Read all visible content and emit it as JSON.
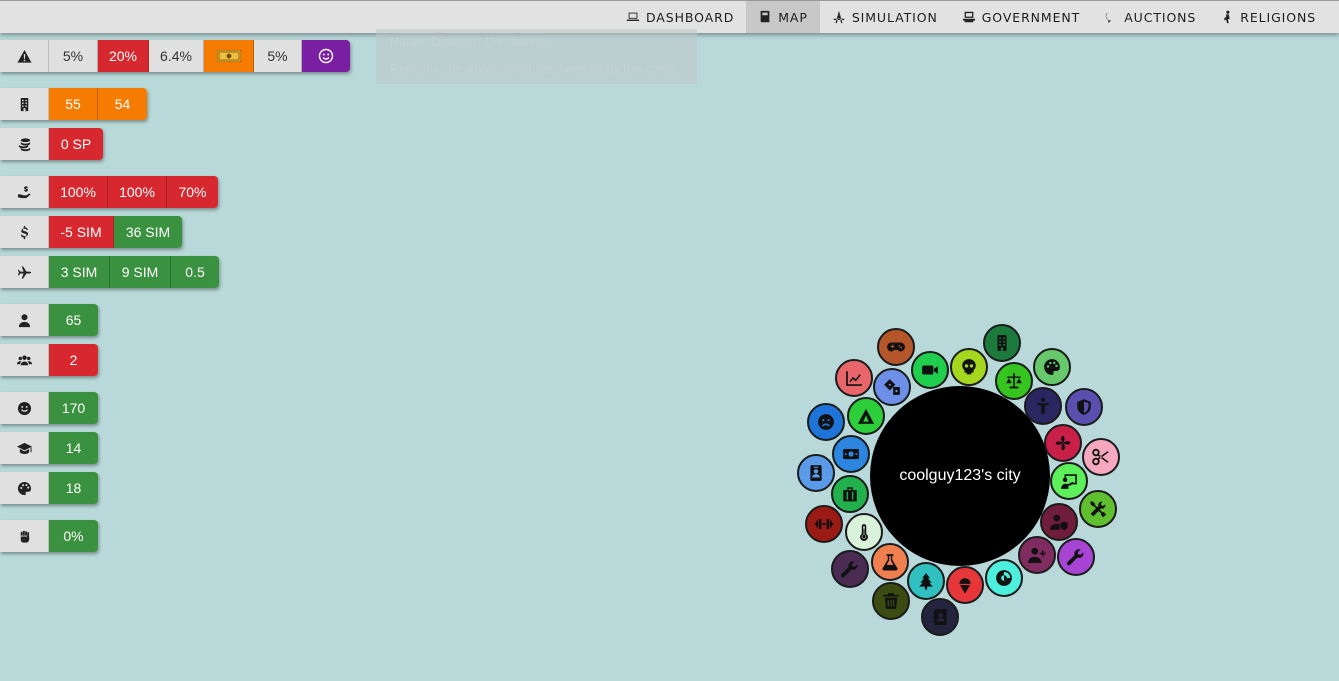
{
  "nav": {
    "items": [
      {
        "label": "DASHBOARD",
        "icon": "laptop-icon"
      },
      {
        "label": "MAP",
        "icon": "book-icon"
      },
      {
        "label": "SIMULATION",
        "icon": "atom-icon"
      },
      {
        "label": "GOVERNMENT",
        "icon": "podium-icon"
      },
      {
        "label": "AUCTIONS",
        "icon": "speech-bubble-icon"
      },
      {
        "label": "RELIGIONS",
        "icon": "praying-icon"
      }
    ],
    "active": "MAP"
  },
  "notice": {
    "line1": "Nature Disaster: 1% chance",
    "line2": "Recently, the whole world has been hit by this crisis."
  },
  "stats": {
    "crisis": {
      "icon": "warning-icon",
      "values": [
        "5%",
        "20%",
        "6.4%",
        "",
        "5%",
        ""
      ],
      "badge_icon": "banknote-icon",
      "mood_icon": "smile-icon"
    },
    "buildings": {
      "icon": "building-icon",
      "values": [
        "55",
        "54"
      ]
    },
    "sp": {
      "icon": "coins-icon",
      "values": [
        "0 SP"
      ]
    },
    "taxes": {
      "icon": "hand-money-icon",
      "values": [
        "100%",
        "100%",
        "70%"
      ]
    },
    "money": {
      "icon": "dollar-icon",
      "values": [
        "-5 SIM",
        "36 SIM"
      ]
    },
    "travel": {
      "icon": "airplane-icon",
      "values": [
        "3 SIM",
        "9 SIM",
        "0.5"
      ]
    },
    "population": {
      "icon": "user-icon",
      "values": [
        "65"
      ]
    },
    "groups": {
      "icon": "users-icon",
      "values": [
        "2"
      ]
    },
    "happiness": {
      "icon": "smile-icon",
      "values": [
        "170"
      ]
    },
    "education": {
      "icon": "graduation-cap-icon",
      "values": [
        "14"
      ]
    },
    "culture": {
      "icon": "palette-icon",
      "values": [
        "18"
      ]
    },
    "protest": {
      "icon": "fist-icon",
      "values": [
        "0%"
      ]
    }
  },
  "city": {
    "name": "coolguy123's city",
    "districts": [
      {
        "icon": "gamepad-icon",
        "color": "#b5562a"
      },
      {
        "icon": "video-icon",
        "color": "#1fce4c"
      },
      {
        "icon": "skull-icon",
        "color": "#a5d71e"
      },
      {
        "icon": "building-icon",
        "color": "#1c7a3c"
      },
      {
        "icon": "palette-icon",
        "color": "#66c86a"
      },
      {
        "icon": "chart-icon",
        "color": "#e8666a"
      },
      {
        "icon": "dice-icon",
        "color": "#6d8fe8"
      },
      {
        "icon": "scale-icon",
        "color": "#36c41e"
      },
      {
        "icon": "person-icon",
        "color": "#2a2660"
      },
      {
        "icon": "shield-icon",
        "color": "#5a4faf"
      },
      {
        "icon": "frown-icon",
        "color": "#1e74d8"
      },
      {
        "icon": "tent-icon",
        "color": "#2ccf3a"
      },
      {
        "icon": "fan-icon",
        "color": "#c9204a"
      },
      {
        "icon": "scissors-icon",
        "color": "#f6a8c0"
      },
      {
        "icon": "money-bill-icon",
        "color": "#2c86e0"
      },
      {
        "icon": "teacher-icon",
        "color": "#5df05a"
      },
      {
        "icon": "id-card-icon",
        "color": "#5a9ae8"
      },
      {
        "icon": "tools-icon",
        "color": "#5fbf2e"
      },
      {
        "icon": "briefcase-icon",
        "color": "#22b04d"
      },
      {
        "icon": "user-shield-icon",
        "color": "#6f1d3a"
      },
      {
        "icon": "dumbbell-icon",
        "color": "#9c1a14"
      },
      {
        "icon": "thermometer-icon",
        "color": "#d9f2da"
      },
      {
        "icon": "user-plus-icon",
        "color": "#802c60"
      },
      {
        "icon": "wrench-icon",
        "color": "#a744d4"
      },
      {
        "icon": "wrench-icon",
        "color": "#4a2c52"
      },
      {
        "icon": "flask-icon",
        "color": "#f07f50"
      },
      {
        "icon": "tree-icon",
        "color": "#2fc0bf"
      },
      {
        "icon": "ice-cream-icon",
        "color": "#e6363a"
      },
      {
        "icon": "contrast-icon",
        "color": "#4cf0dc"
      },
      {
        "icon": "trash-icon",
        "color": "#3a4c10"
      },
      {
        "icon": "contact-book-icon",
        "color": "#25243e"
      }
    ]
  }
}
